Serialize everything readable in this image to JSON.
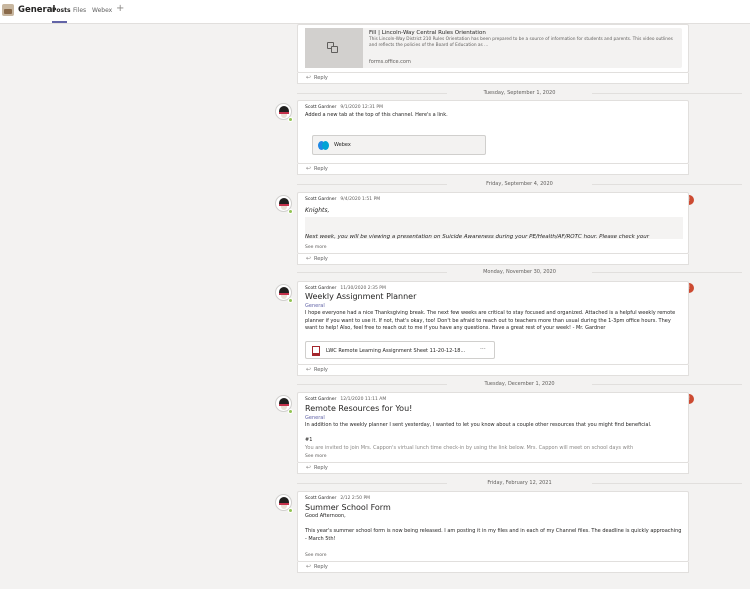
{
  "header": {
    "title": "General",
    "tabs": [
      "Posts",
      "Files",
      "Webex"
    ],
    "add_tab": "+"
  },
  "reply_label": "Reply",
  "see_more_label": "See more",
  "link_preview": {
    "title": "Fill | Lincoln-Way Central Rules Orientation",
    "description": "This Lincoln-Way District 210 Rules Orientation has been prepared to be a source of information for students and parents. This video outlines and reflects the policies of the Board of Education as ...",
    "url": "forms.office.com"
  },
  "dates": [
    "Tuesday, September 1, 2020",
    "Friday, September 4, 2020",
    "Monday, November 30, 2020",
    "Tuesday, December 1, 2020",
    "Friday, February 12, 2021"
  ],
  "posts": [
    {
      "author": "Scott Gardner",
      "time": "9/1/2020 12:31 PM",
      "body": "Added a new tab at the top of this channel. Here's a link.",
      "tab_chip": "Webex"
    },
    {
      "author": "Scott Gardner",
      "time": "9/4/2020 1:51 PM",
      "line1": "Knights,",
      "line2": "Next week, you will be viewing a presentation on Suicide Awareness during your PE/Health/AF/ROTC hour. Please check your",
      "important": "!"
    },
    {
      "author": "Scott Gardner",
      "time": "11/30/2020 2:35 PM",
      "subject": "Weekly Assignment Planner",
      "channel": "General",
      "body": "I hope everyone had a nice Thanksgiving break.  The next few weeks are critical to stay focused and organized.  Attached is a helpful weekly remote planner if you want to use it.  If not, that's okay, too!  Don't be afraid to reach out to teachers more than usual during the 1-3pm office hours.  They want to help!  Also, feel free to reach out to me if you have any questions.  Have a great rest of your week! - Mr. Gardner",
      "file": "LWC Remote Learning Assignment Sheet 11-20-12-18...",
      "file_more": "···",
      "important": "!"
    },
    {
      "author": "Scott Gardner",
      "time": "12/1/2020 11:11 AM",
      "subject": "Remote Resources for You!",
      "channel": "General",
      "line1": "In addition to the weekly planner I sent yesterday, I wanted to let you know about a couple other resources that you might find beneficial.",
      "line2": "#1",
      "line3": "You are invited to join Mrs. Cappon's virtual lunch time check-in by using the link below.  Mrs. Cappon will meet on school days with",
      "important": "!"
    },
    {
      "author": "Scott Gardner",
      "time": "2/12 2:50 PM",
      "subject": "Summer School Form",
      "line1": "Good Afternoon,",
      "line2": "This year's summer school form is now being released.  I am posting it in my files and in each of my Channel files.  The deadline is quickly approaching - March 5th!"
    }
  ],
  "colors": {
    "accent": "#6264a7",
    "important": "#cc4a31",
    "presence": "#92c353"
  }
}
